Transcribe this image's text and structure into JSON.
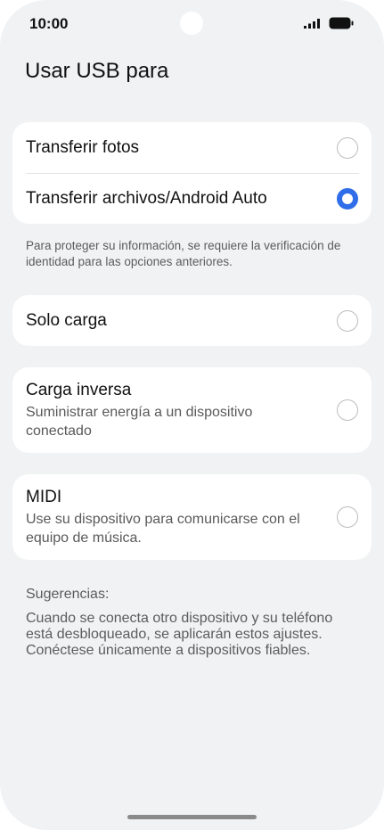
{
  "status_bar": {
    "time": "10:00",
    "icons": [
      "signal-icon",
      "battery-icon"
    ]
  },
  "page": {
    "title": "Usar USB para"
  },
  "group1": {
    "options": [
      {
        "label": "Transferir fotos",
        "selected": false
      },
      {
        "label": "Transferir archivos/Android Auto",
        "selected": true
      }
    ],
    "note": "Para proteger su información, se requiere la verificación de identidad para las opciones anteriores."
  },
  "solo_carga": {
    "label": "Solo carga",
    "selected": false
  },
  "carga_inversa": {
    "label": "Carga inversa",
    "description": "Suministrar energía a un dispositivo conectado",
    "selected": false
  },
  "midi": {
    "label": "MIDI",
    "description": "Use su dispositivo para comunicarse con el equipo de música.",
    "selected": false
  },
  "tips": {
    "label": "Sugerencias:",
    "text": "Cuando se conecta otro dispositivo y su teléfono está desbloqueado, se aplicarán estos ajustes. Conéctese únicamente a dispositivos fiables."
  },
  "colors": {
    "accent": "#2f6ee8",
    "background": "#f1f2f4",
    "card": "#ffffff"
  }
}
